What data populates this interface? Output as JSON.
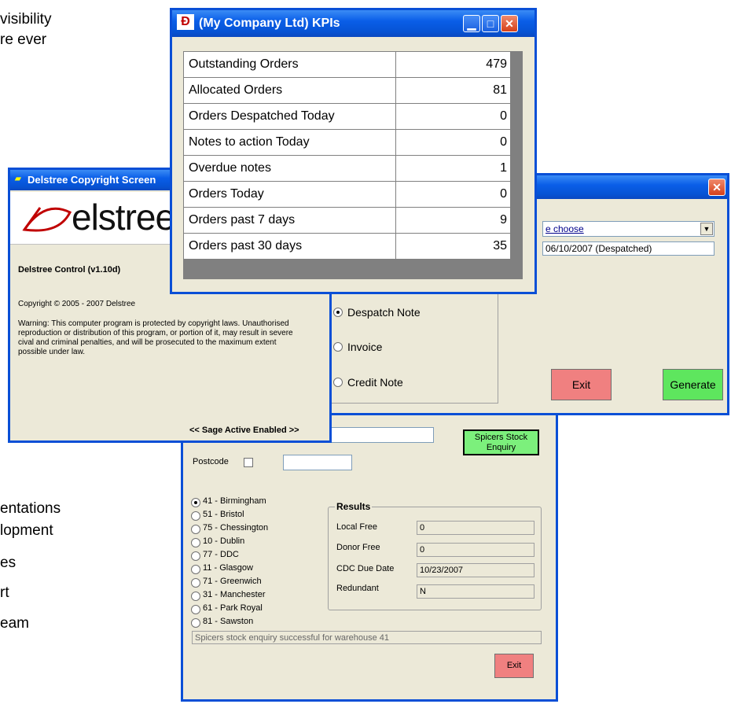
{
  "background_slide": {
    "top_lines": [
      "visibility",
      "re ever"
    ],
    "bullets": [
      "entations",
      "lopment",
      "es",
      "rt",
      "eam"
    ]
  },
  "copyright_window": {
    "title": "Delstree Copyright Screen",
    "logo_text": "elstree",
    "product_name": "Delstree Control (v1.10d)",
    "copyright": "Copyright © 2005 - 2007 Delstree",
    "warning": "Warning: This computer program is protected by copyright laws. Unauthorised reproduction or distribution of this program, or portion of it, may result in severe cival and criminal penalties, and will be prosecuted to the maximum extent possible under law.",
    "footer": "<< Sage Active Enabled >>"
  },
  "document_window": {
    "dropdown_value": "e choose",
    "list_item": "06/10/2007 (Despatched)",
    "radios": [
      {
        "label": "Despatch Note",
        "checked": true
      },
      {
        "label": "Invoice",
        "checked": false
      },
      {
        "label": "Credit Note",
        "checked": false
      }
    ],
    "exit_label": "Exit",
    "generate_label": "Generate",
    "colors": {
      "exit": "#f08080",
      "generate": "#5ee65e"
    }
  },
  "kpi_window": {
    "title": "(My Company Ltd) KPIs",
    "rows": [
      {
        "label": "Outstanding Orders",
        "value": "479"
      },
      {
        "label": "Allocated Orders",
        "value": "81"
      },
      {
        "label": "Orders Despatched Today",
        "value": "0"
      },
      {
        "label": "Notes to action Today",
        "value": "0"
      },
      {
        "label": "Overdue notes",
        "value": "1"
      },
      {
        "label": "Orders Today",
        "value": "0"
      },
      {
        "label": "Orders past 7 days",
        "value": "9"
      },
      {
        "label": "Orders past 30 days",
        "value": "35"
      }
    ]
  },
  "stock_window": {
    "spicers_button": "Spicers Stock Enquiry",
    "postcode_label": "Postcode",
    "warehouses": [
      {
        "label": "41 - Birmingham",
        "checked": true
      },
      {
        "label": "51 - Bristol",
        "checked": false
      },
      {
        "label": "75 - Chessington",
        "checked": false
      },
      {
        "label": "10 - Dublin",
        "checked": false
      },
      {
        "label": "77 - DDC",
        "checked": false
      },
      {
        "label": "11 - Glasgow",
        "checked": false
      },
      {
        "label": "71 - Greenwich",
        "checked": false
      },
      {
        "label": "31 - Manchester",
        "checked": false
      },
      {
        "label": "61 - Park Royal",
        "checked": false
      },
      {
        "label": "81 - Sawston",
        "checked": false
      }
    ],
    "results": {
      "title": "Results",
      "fields": [
        {
          "label": "Local Free",
          "value": "0"
        },
        {
          "label": "Donor Free",
          "value": "0"
        },
        {
          "label": "CDC Due Date",
          "value": "10/23/2007"
        },
        {
          "label": "Redundant",
          "value": "N"
        }
      ]
    },
    "status": "Spicers stock enquiry successful for warehouse 41",
    "exit_label": "Exit"
  }
}
